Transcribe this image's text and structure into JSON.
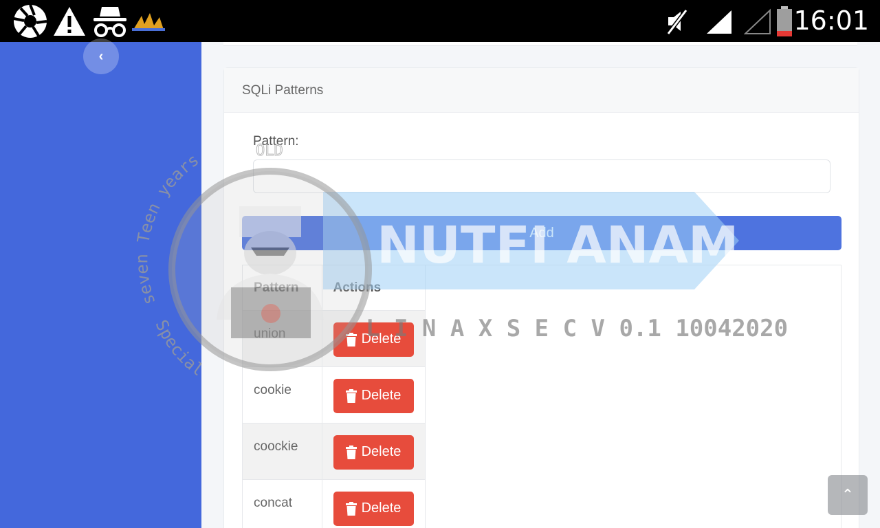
{
  "status_bar": {
    "time": "16:01",
    "icons": [
      "aperture-icon",
      "warning-icon",
      "incognito-icon",
      "app-notification-icon",
      "mute-icon",
      "signal-icon",
      "signal-empty-icon",
      "battery-low-icon"
    ]
  },
  "sidebar": {
    "toggle_icon": "chevron-left-icon"
  },
  "card": {
    "title": "SQLi Patterns",
    "pattern_label": "Pattern:",
    "pattern_value": "",
    "add_label": "Add"
  },
  "table": {
    "headers": [
      "Pattern",
      "Actions"
    ],
    "rows": [
      {
        "pattern": "union",
        "action": "Delete"
      },
      {
        "pattern": "cookie",
        "action": "Delete"
      },
      {
        "pattern": "coockie",
        "action": "Delete"
      },
      {
        "pattern": "concat",
        "action": "Delete"
      }
    ]
  },
  "scroll_top_icon": "chevron-up-icon",
  "watermark": {
    "ring_text_top": "seven Teen years",
    "ring_text_bottom": "Special",
    "old": "OLD",
    "brand": "NUTFI ANAM",
    "version": "L I N A X S E C V 0.1  10042020"
  },
  "colors": {
    "sidebar": "#4468dc",
    "primary": "#4e73df",
    "danger": "#e74c3c",
    "status_bar": "#000000",
    "battery_low": "#e53935"
  }
}
